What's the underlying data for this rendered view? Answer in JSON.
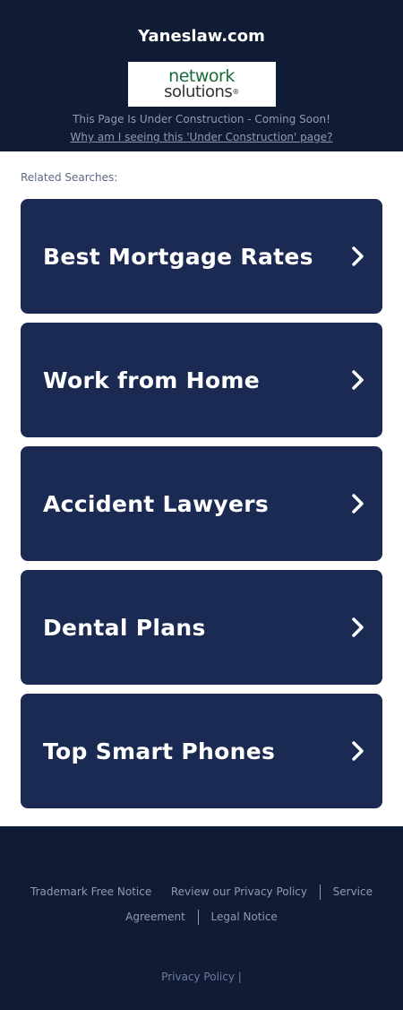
{
  "header": {
    "site_title": "Yaneslaw.com",
    "logo": {
      "line1": "network",
      "line2": "solutions",
      "reg": "®"
    },
    "construction_text": "This Page Is Under Construction - Coming Soon!",
    "why_link": "Why am I seeing this 'Under Construction' page?"
  },
  "main": {
    "related_label": "Related Searches:",
    "results": [
      {
        "label": "Best Mortgage Rates"
      },
      {
        "label": "Work from Home"
      },
      {
        "label": "Accident Lawyers"
      },
      {
        "label": "Dental Plans"
      },
      {
        "label": "Top Smart Phones"
      }
    ],
    "chevron_icon": "chevron-right-icon"
  },
  "footer": {
    "links": {
      "trademark": "Trademark Free Notice",
      "privacy_review": "Review our Privacy Policy",
      "service_agreement": "Service Agreement",
      "legal": "Legal Notice"
    },
    "privacy_policy": "Privacy Policy",
    "pipe": "|"
  },
  "colors": {
    "header_bg": "#101c36",
    "card_bg": "#1b2a52",
    "logo_green": "#186a3b"
  }
}
